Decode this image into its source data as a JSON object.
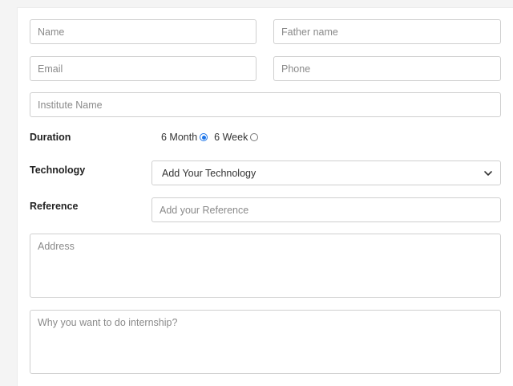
{
  "form": {
    "name_placeholder": "Name",
    "father_placeholder": "Father name",
    "email_placeholder": "Email",
    "phone_placeholder": "Phone",
    "institute_placeholder": "Institute Name",
    "duration_label": "Duration",
    "duration_options": [
      {
        "label": "6 Month",
        "selected": true
      },
      {
        "label": "6 Week",
        "selected": false
      }
    ],
    "technology_label": "Technology",
    "technology_selected": "Add Your Technology",
    "reference_label": "Reference",
    "reference_placeholder": "Add your Reference",
    "address_placeholder": "Address",
    "why_placeholder": "Why you want to do internship?"
  },
  "colors": {
    "radio_selected": "#1a73e8",
    "border": "#cfcfcf",
    "placeholder_text": "#8a8a8a"
  },
  "icons": {
    "select": "chevron-down-icon"
  }
}
